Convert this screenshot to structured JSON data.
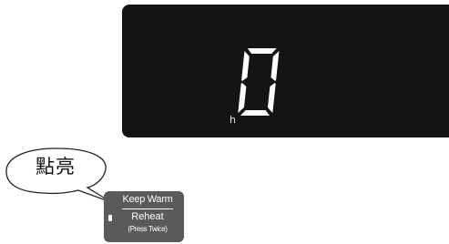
{
  "display": {
    "digit": "0",
    "unit": "h"
  },
  "callout": {
    "text": "點亮"
  },
  "keep_warm_button": {
    "label_top": "Keep Warm",
    "label_mid": "Reheat",
    "label_sub": "(Press Twice)"
  },
  "colors": {
    "lcd_background": "#141414",
    "segment": "#ffffff",
    "button_background": "#5a5a5a"
  }
}
